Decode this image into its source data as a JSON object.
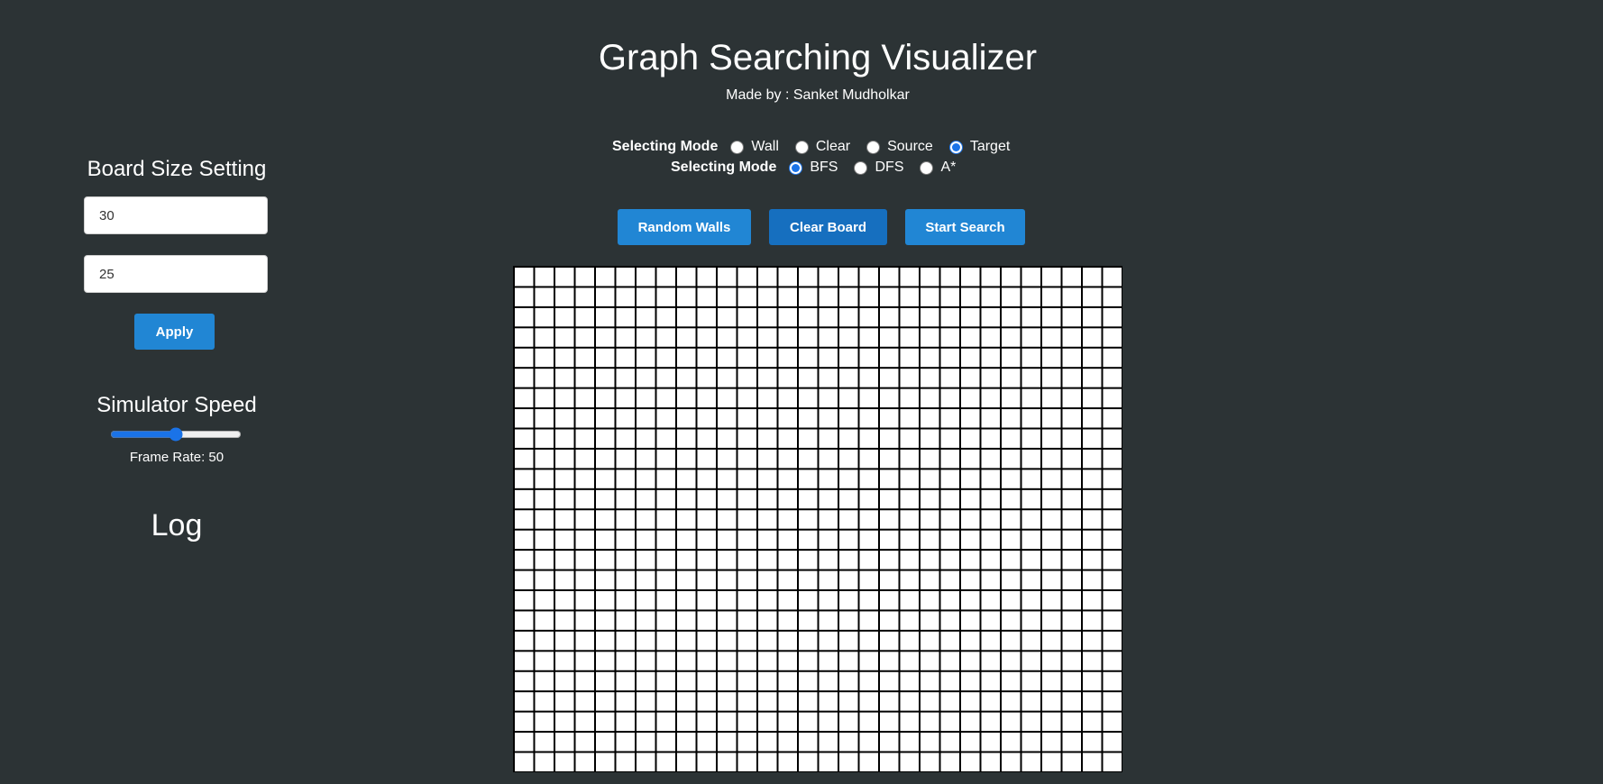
{
  "header": {
    "title": "Graph Searching Visualizer",
    "subtitle": "Made by : Sanket Mudholkar"
  },
  "sidebar": {
    "board_size_heading": "Board Size Setting",
    "rows_value": "30",
    "cols_value": "25",
    "apply_label": "Apply",
    "speed_heading": "Simulator Speed",
    "speed_value": 50,
    "frame_rate_text": "Frame Rate: 50",
    "log_heading": "Log"
  },
  "selecting_mode": {
    "label": "Selecting Mode",
    "options": [
      "Wall",
      "Clear",
      "Source",
      "Target"
    ],
    "selected": "Target"
  },
  "algorithm_mode": {
    "label": "Selecting Mode",
    "options": [
      "BFS",
      "DFS",
      "A*"
    ],
    "selected": "BFS"
  },
  "toolbar": {
    "random_walls_label": "Random Walls",
    "clear_board_label": "Clear Board",
    "start_search_label": "Start Search"
  },
  "board": {
    "columns": 30,
    "rows": 25
  },
  "colors": {
    "background": "#2c3335",
    "button": "#2186d4",
    "button_active": "#166fbf",
    "accent": "#1a73e8"
  }
}
